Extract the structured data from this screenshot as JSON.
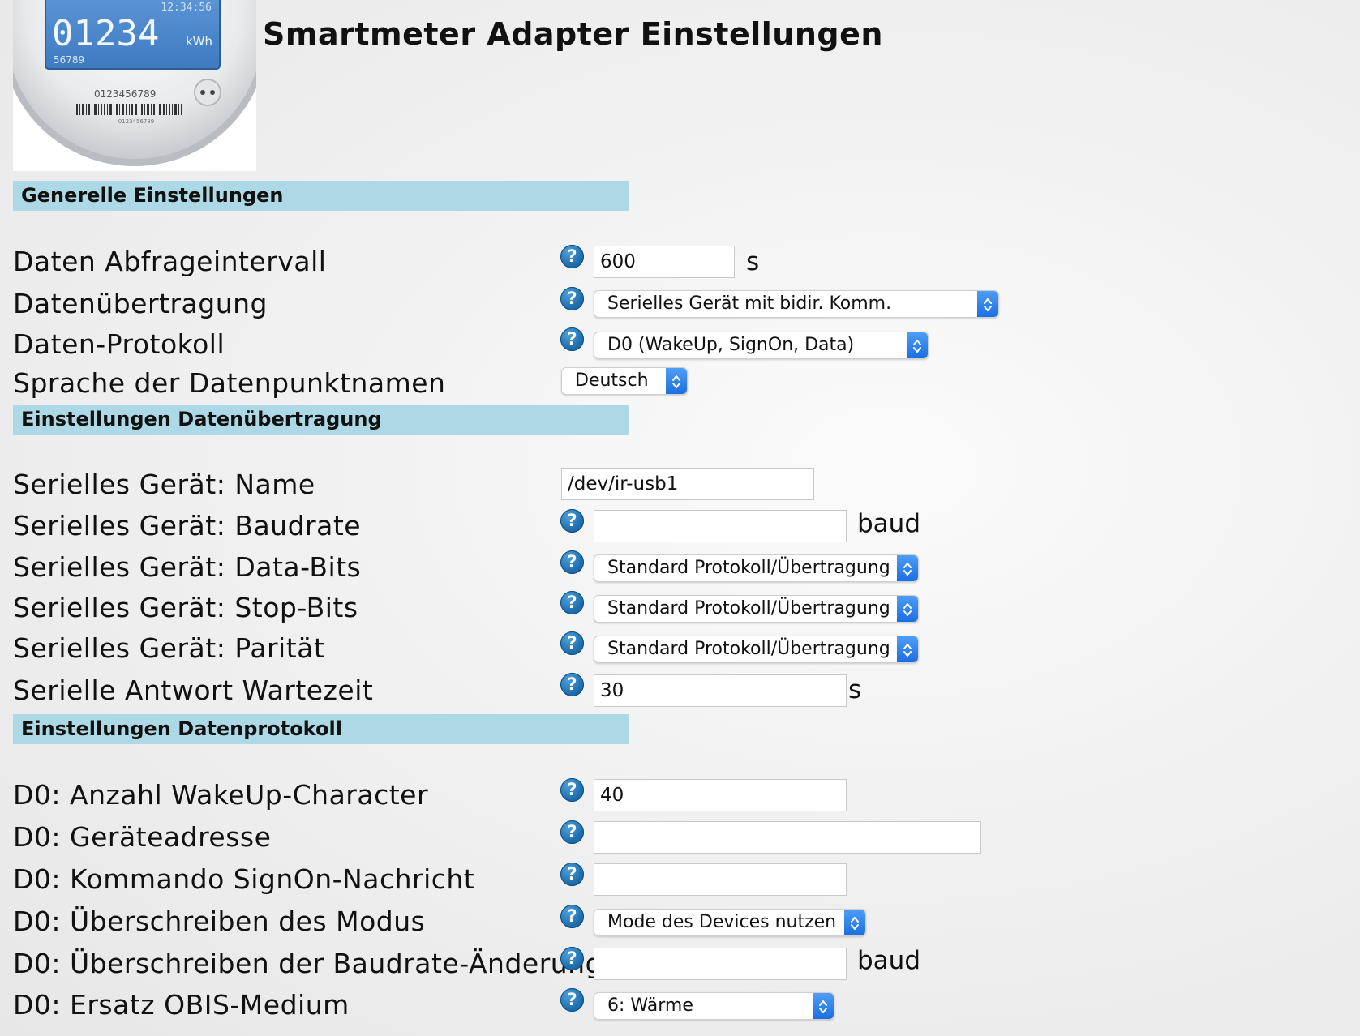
{
  "title": "Smartmeter Adapter Einstellungen",
  "logo": {
    "icon": "smart-meter-icon",
    "time": "12:34:56",
    "reading": "01234",
    "unit": "kWh",
    "small_number": "56789",
    "serial": "0123456789",
    "barcode_text": "0123456789"
  },
  "sections": {
    "general": "Generelle Einstellungen",
    "transfer": "Einstellungen Datenübertragung",
    "protocol": "Einstellungen Datenprotokoll"
  },
  "fields": {
    "interval": {
      "label": "Daten Abfrageintervall",
      "value": "600",
      "unit": "s"
    },
    "transmission": {
      "label": "Datenübertragung",
      "value": "Serielles Gerät mit bidir. Komm."
    },
    "protocol": {
      "label": "Daten-Protokoll",
      "value": "D0 (WakeUp, SignOn, Data)"
    },
    "language": {
      "label": "Sprache der Datenpunktnamen",
      "value": "Deutsch"
    },
    "serial_name": {
      "label": "Serielles Gerät: Name",
      "value": "/dev/ir-usb1"
    },
    "serial_baud": {
      "label": "Serielles Gerät: Baudrate",
      "value": "",
      "unit": "baud"
    },
    "serial_databits": {
      "label": "Serielles Gerät: Data-Bits",
      "value": "Standard Protokoll/Übertragung"
    },
    "serial_stopbits": {
      "label": "Serielles Gerät: Stop-Bits",
      "value": "Standard Protokoll/Übertragung"
    },
    "serial_parity": {
      "label": "Serielles Gerät: Parität",
      "value": "Standard Protokoll/Übertragung"
    },
    "serial_wait": {
      "label": "Serielle Antwort Wartezeit",
      "value": "30",
      "unit": "s"
    },
    "d0_wakeup": {
      "label": "D0: Anzahl WakeUp-Character",
      "value": "40"
    },
    "d0_address": {
      "label": "D0: Geräteadresse",
      "value": ""
    },
    "d0_signon": {
      "label": "D0: Kommando SignOn-Nachricht",
      "value": ""
    },
    "d0_mode": {
      "label": "D0: Überschreiben des Modus",
      "value": "Mode des Devices nutzen"
    },
    "d0_baud_override": {
      "label": "D0: Überschreiben der Baudrate-Änderung",
      "value": "",
      "unit": "baud"
    },
    "d0_obis": {
      "label": "D0: Ersatz OBIS-Medium",
      "value": "6: Wärme"
    }
  },
  "help_icon": "help-icon",
  "help_glyph": "?",
  "select_arrow_icon": "updown-chevron-icon"
}
